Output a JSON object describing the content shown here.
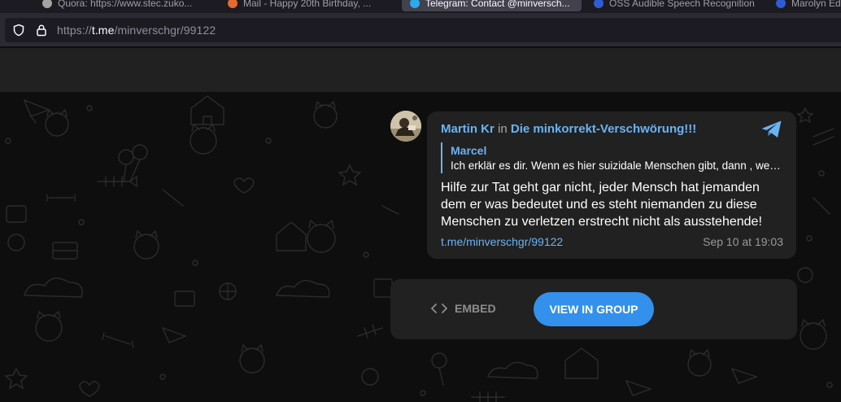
{
  "browser": {
    "tabs": [
      {
        "title": "Quora: https://www.stec.zuko...",
        "favicon": "quora-favicon",
        "color": "#a3a3a3"
      },
      {
        "title": "Mail - Happy 20th Birthday, ...",
        "favicon": "mail-favicon",
        "color": "#e66a2c"
      },
      {
        "title": "Telegram: Contact @minversch...",
        "favicon": "telegram-favicon",
        "color": "#2aabee"
      },
      {
        "title": "OSS Audible Speech Recognition",
        "favicon": "oss-favicon",
        "color": "#2f5bd6"
      },
      {
        "title": "Marolyn Ed...",
        "favicon": "page-favicon",
        "color": "#2f5bd6"
      }
    ],
    "active_tab": 2,
    "url": {
      "prefix": "https://",
      "domain": "t.me",
      "path": "/minverschgr/99122"
    }
  },
  "post": {
    "author": "Martin Kr",
    "in_label": "in",
    "group": "Die minkorrekt-Verschwörung!!!",
    "reply": {
      "name": "Marcel",
      "text": "Ich erklär es dir. Wenn es hier suizidale Menschen gibt, dann , wenn sie sich ernsthaft umbringen wollen"
    },
    "message": "Hilfe zur Tat geht gar nicht, jeder Mensch hat jemanden dem er was bedeutet und es steht niemanden zu diese Menschen zu verletzen erstrecht nicht als ausstehende!",
    "link": "t.me/minverschgr/99122",
    "date": "Sep 10 at 19:03"
  },
  "actions": {
    "embed_label": "EMBED",
    "view_label": "VIEW IN GROUP"
  },
  "colors": {
    "accent": "#6ab3f3",
    "button": "#3390ec",
    "bubble": "#212121",
    "background": "#0e0e0e"
  },
  "icons": [
    "shield-icon",
    "lock-icon",
    "telegram-logo-icon",
    "code-icon",
    "avatar"
  ]
}
